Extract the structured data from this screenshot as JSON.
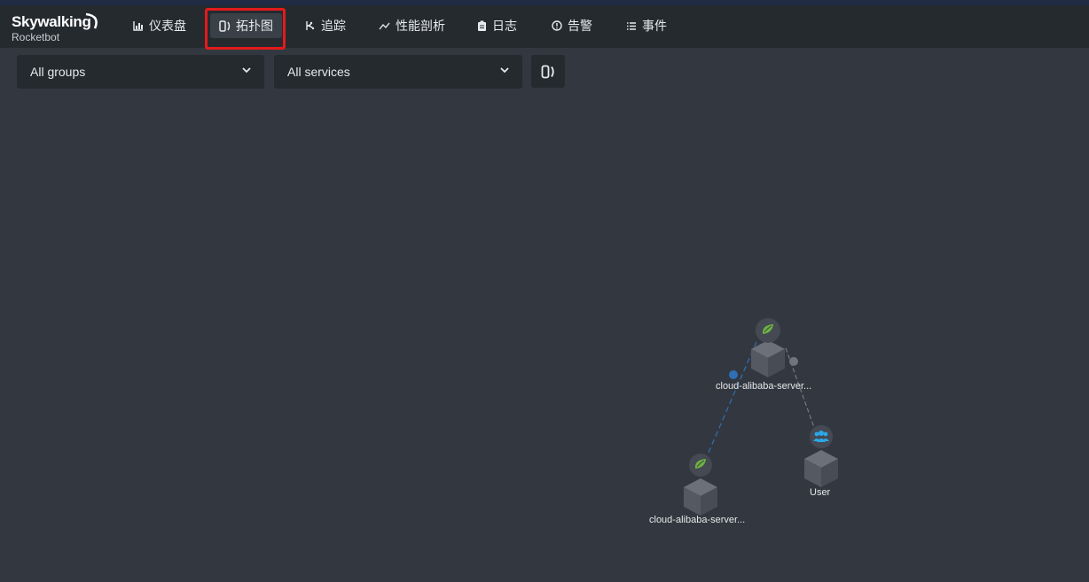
{
  "app": {
    "brand": "Skywalking",
    "subtitle": "Rocketbot"
  },
  "nav": [
    {
      "label": "仪表盘",
      "icon": "bar-chart-icon"
    },
    {
      "label": "拓扑图",
      "icon": "topology-icon",
      "active": true
    },
    {
      "label": "追踪",
      "icon": "trace-icon"
    },
    {
      "label": "性能剖析",
      "icon": "line-chart-icon"
    },
    {
      "label": "日志",
      "icon": "clipboard-icon"
    },
    {
      "label": "告警",
      "icon": "alert-icon"
    },
    {
      "label": "事件",
      "icon": "list-icon"
    }
  ],
  "filters": {
    "group": "All groups",
    "service": "All services"
  },
  "colors": {
    "accent_highlight": "#e31b1b",
    "spring_green": "#6db33f",
    "user_blue": "#2aa8e8",
    "edge_blue": "#2f6fb5"
  },
  "topology": {
    "nodes": [
      {
        "id": "server-top",
        "label": "cloud-alibaba-server...",
        "type": "spring"
      },
      {
        "id": "server-bottom",
        "label": "cloud-alibaba-server...",
        "type": "spring"
      },
      {
        "id": "user",
        "label": "User",
        "type": "user"
      }
    ],
    "edges": [
      {
        "from": "server-top",
        "to": "server-bottom",
        "style": "dashed-blue"
      },
      {
        "from": "server-top",
        "to": "user",
        "style": "dashed-gray"
      }
    ]
  }
}
